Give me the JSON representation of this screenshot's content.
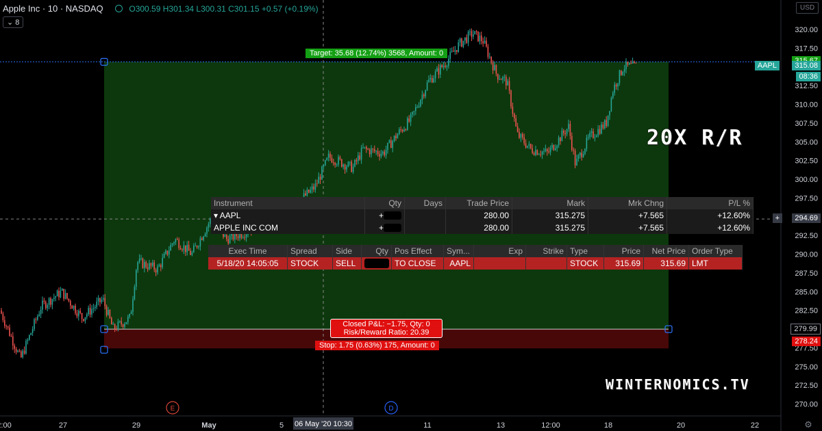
{
  "header": {
    "symbol_line": "Apple Inc · 10 · NASDAQ",
    "ohlc": "O300.59 H301.34 L300.31 C301.15 +0.57 (+0.19%)",
    "indicator_badge": "⌄ 8",
    "currency": "USD"
  },
  "colors": {
    "bg": "#000000",
    "up": "#26a69a",
    "down": "#ef5350",
    "profit_zone": "#0d3a0d",
    "loss_zone": "#4a0808",
    "target": "#14a014",
    "stop": "#e01010"
  },
  "chart_data": {
    "type": "candlestick",
    "ylim": [
      267.5,
      322.5
    ],
    "y_ticks": [
      320.0,
      317.5,
      315.0,
      312.5,
      310.0,
      307.5,
      305.0,
      302.5,
      300.0,
      297.5,
      295.0,
      292.5,
      290.0,
      287.5,
      285.0,
      282.5,
      280.0,
      277.5,
      275.0,
      272.5,
      270.0
    ],
    "x_tick_labels": [
      "2:00",
      "27",
      "29",
      "May",
      "5",
      "11",
      "13",
      "12:00",
      "18",
      "20",
      "22"
    ],
    "crosshair_date_label": "06 May '20  10:30",
    "close_path": [
      [
        0,
        282.5
      ],
      [
        30,
        276
      ],
      [
        60,
        283
      ],
      [
        90,
        285
      ],
      [
        120,
        281.5
      ],
      [
        150,
        284
      ],
      [
        165,
        280
      ],
      [
        190,
        281.5
      ],
      [
        200,
        289
      ],
      [
        230,
        288
      ],
      [
        255,
        292
      ],
      [
        280,
        290
      ],
      [
        310,
        295
      ],
      [
        330,
        292
      ],
      [
        360,
        293
      ],
      [
        400,
        295.5
      ],
      [
        430,
        296.5
      ],
      [
        460,
        299
      ],
      [
        480,
        303
      ],
      [
        515,
        301.5
      ],
      [
        530,
        304
      ],
      [
        560,
        303.5
      ],
      [
        580,
        306
      ],
      [
        600,
        308
      ],
      [
        625,
        313
      ],
      [
        650,
        315.5
      ],
      [
        670,
        318
      ],
      [
        690,
        319.5
      ],
      [
        705,
        318.5
      ],
      [
        725,
        314
      ],
      [
        740,
        313
      ],
      [
        755,
        306
      ],
      [
        775,
        304
      ],
      [
        800,
        303.5
      ],
      [
        830,
        307
      ],
      [
        840,
        302
      ],
      [
        860,
        305.5
      ],
      [
        885,
        307.5
      ],
      [
        895,
        312
      ],
      [
        910,
        315
      ],
      [
        930,
        315.1
      ]
    ],
    "annotations": {
      "target": "Target: 35.68 (12.74%) 3568, Amount: 0",
      "stop": "Stop: 1.75 (0.63%) 175, Amount: 0",
      "closed_pl": "Closed P&L: −1.75, Qty: 0",
      "risk_reward": "Risk/Reward Ratio: 20.39",
      "target_price": 315.67,
      "entry_price": 279.99,
      "stop_price": 278.24
    },
    "price_tags": [
      {
        "label": "315.67",
        "value": 315.67,
        "kind": "target"
      },
      {
        "label": "315.08",
        "value": 315.08,
        "kind": "last",
        "symbol": "AAPL"
      },
      {
        "label": "08:36",
        "value": 314.0,
        "kind": "countdown"
      },
      {
        "label": "294.69",
        "value": 294.69,
        "kind": "crosshair"
      },
      {
        "label": "279.99",
        "value": 279.99,
        "kind": "entry"
      },
      {
        "label": "278.24",
        "value": 278.24,
        "kind": "stop"
      }
    ],
    "events": [
      {
        "label": "E"
      },
      {
        "label": "D"
      }
    ]
  },
  "overlay_text": {
    "rr": "20X R/R",
    "site": "WINTERNOMICS.TV"
  },
  "positions_table": {
    "headers": [
      "Instrument",
      "Qty",
      "Days",
      "Trade Price",
      "Mark",
      "Mrk Chng",
      "P/L %"
    ],
    "rows": [
      {
        "instrument": "▾ AAPL",
        "qty": "+",
        "days": "",
        "trade_price": "280.00",
        "mark": "315.275",
        "mrk_chng": "+7.565",
        "pl": "+12.60%"
      },
      {
        "instrument": "APPLE INC COM",
        "qty": "+",
        "days": "",
        "trade_price": "280.00",
        "mark": "315.275",
        "mrk_chng": "+7.565",
        "pl": "+12.60%"
      }
    ]
  },
  "orders_table": {
    "headers": [
      "Exec Time",
      "Spread",
      "Side",
      "Qty",
      "Pos Effect",
      "Sym...",
      "Exp",
      "Strike",
      "Type",
      "Price",
      "Net Price",
      "Order Type"
    ],
    "row": {
      "exec_time": "5/18/20 14:05:05",
      "spread": "STOCK",
      "side": "SELL",
      "qty": "",
      "pos_effect": "TO CLOSE",
      "sym": "AAPL",
      "exp": "",
      "strike": "",
      "type": "STOCK",
      "price": "315.69",
      "net_price": "315.69",
      "order_type": "LMT"
    }
  }
}
